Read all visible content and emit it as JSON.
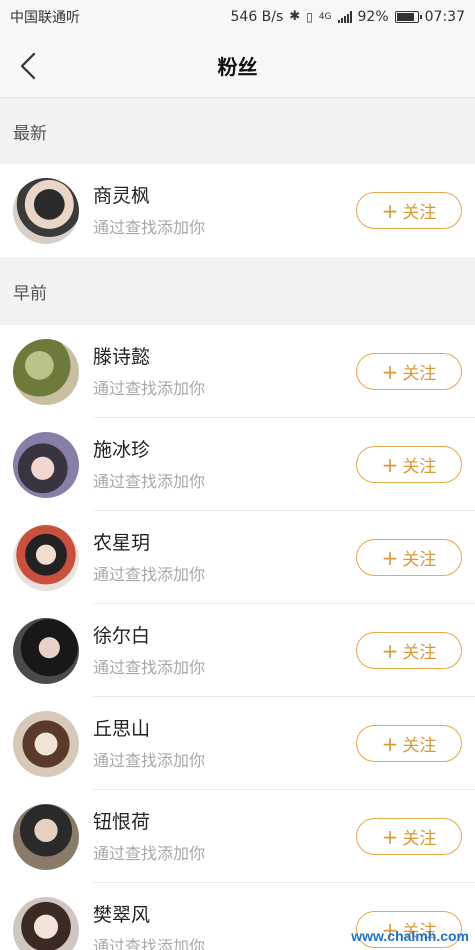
{
  "status_bar": {
    "carrier": "中国联通听",
    "speed": "546 B/s",
    "network": "4G",
    "battery": "92%",
    "battery_level": 0.92,
    "time": "07:37"
  },
  "nav": {
    "title": "粉丝",
    "back_icon": "chevron-left-icon"
  },
  "sections": [
    {
      "header": "最新",
      "users": [
        {
          "name": "商灵枫",
          "subtitle": "通过查找添加你",
          "follow_label": "关注"
        }
      ]
    },
    {
      "header": "早前",
      "users": [
        {
          "name": "滕诗懿",
          "subtitle": "通过查找添加你",
          "follow_label": "关注"
        },
        {
          "name": "施冰珍",
          "subtitle": "通过查找添加你",
          "follow_label": "关注"
        },
        {
          "name": "农星玥",
          "subtitle": "通过查找添加你",
          "follow_label": "关注"
        },
        {
          "name": "徐尔白",
          "subtitle": "通过查找添加你",
          "follow_label": "关注"
        },
        {
          "name": "丘思山",
          "subtitle": "通过查找添加你",
          "follow_label": "关注"
        },
        {
          "name": "钮恨荷",
          "subtitle": "通过查找添加你",
          "follow_label": "关注"
        },
        {
          "name": "樊翠风",
          "subtitle": "通过查找添加你",
          "follow_label": "关注"
        }
      ]
    }
  ],
  "watermark": "www.chalmh.com",
  "colors": {
    "accent": "#e3a94a",
    "accent_text": "#d89a36",
    "section_bg": "#f2f2f2",
    "nav_bg": "#f7f7f7"
  }
}
